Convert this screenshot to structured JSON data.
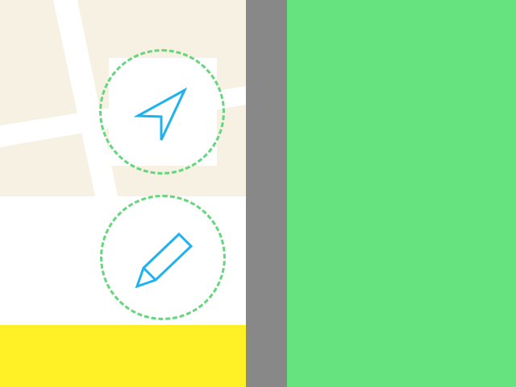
{
  "colors": {
    "map_background": "#f6f1e3",
    "road": "#ffffff",
    "panel_background": "#ffffff",
    "bottom_bar": "#fff125",
    "divider": "#888888",
    "right_panel": "#66e37e",
    "icon_stroke": "#1eb3ee",
    "ring_dashed": "#66d67e"
  },
  "icons": {
    "locate": "navigation-arrow-icon",
    "edit": "pencil-icon"
  }
}
